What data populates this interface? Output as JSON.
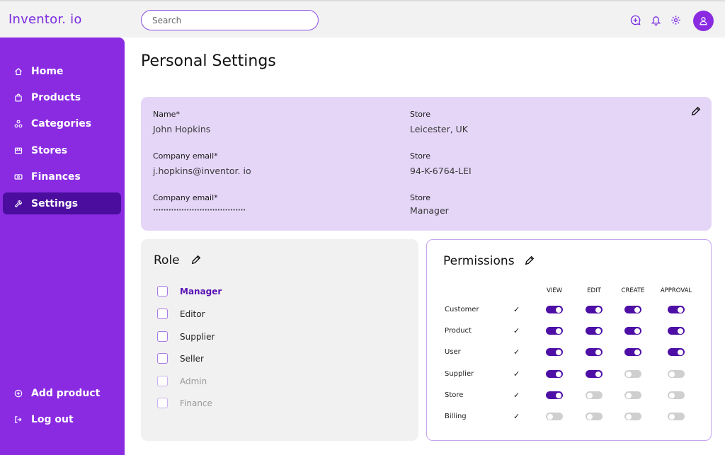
{
  "app": {
    "logo": "Inventor. io"
  },
  "search": {
    "placeholder": "Search"
  },
  "sidebar": {
    "items": [
      {
        "label": "Home",
        "icon": "home-icon"
      },
      {
        "label": "Products",
        "icon": "bag-icon"
      },
      {
        "label": "Categories",
        "icon": "shapes-icon"
      },
      {
        "label": "Stores",
        "icon": "store-icon"
      },
      {
        "label": "Finances",
        "icon": "money-icon"
      },
      {
        "label": "Settings",
        "icon": "wrench-icon",
        "active": true
      }
    ],
    "bottom": [
      {
        "label": "Add product",
        "icon": "plus-circle-icon"
      },
      {
        "label": "Log out",
        "icon": "logout-icon"
      }
    ]
  },
  "page": {
    "title": "Personal Settings"
  },
  "profile": {
    "fields": [
      {
        "label": "Name*",
        "value": "John Hopkins"
      },
      {
        "label": "Store",
        "value": "Leicester, UK"
      },
      {
        "label": "Company email*",
        "value": "j.hopkins@inventor. io"
      },
      {
        "label": "Store",
        "value": "94-K-6764-LEI"
      },
      {
        "label": "Company email*",
        "value": "••••••••••••••••••••••••••••••••••••"
      },
      {
        "label": "Store",
        "value": "Manager"
      }
    ]
  },
  "role": {
    "title": "Role",
    "options": [
      {
        "label": "Manager",
        "state": "selected"
      },
      {
        "label": "Editor",
        "state": "normal"
      },
      {
        "label": "Supplier",
        "state": "normal"
      },
      {
        "label": "Seller",
        "state": "normal"
      },
      {
        "label": "Admin",
        "state": "disabled"
      },
      {
        "label": "Finance",
        "state": "disabled"
      }
    ]
  },
  "permissions": {
    "title": "Permissions",
    "columns": [
      "VIEW",
      "EDIT",
      "CREATE",
      "APPROVAL"
    ],
    "check_mark": "✓",
    "rows": [
      {
        "label": "Customer",
        "values": [
          true,
          true,
          true,
          true
        ]
      },
      {
        "label": "Product",
        "values": [
          true,
          true,
          true,
          true
        ]
      },
      {
        "label": "User",
        "values": [
          true,
          true,
          true,
          true
        ]
      },
      {
        "label": "Supplier",
        "values": [
          true,
          true,
          false,
          false
        ]
      },
      {
        "label": "Store",
        "values": [
          true,
          false,
          false,
          false
        ]
      },
      {
        "label": "Billing",
        "values": [
          false,
          false,
          false,
          false
        ]
      }
    ]
  },
  "colors": {
    "brand": "#8a2be2",
    "active_nav": "#4a0d9e",
    "profile_bg": "#e5d6f8",
    "toggle_on": "#4e0fa6",
    "toggle_off": "#cfcfcf"
  }
}
